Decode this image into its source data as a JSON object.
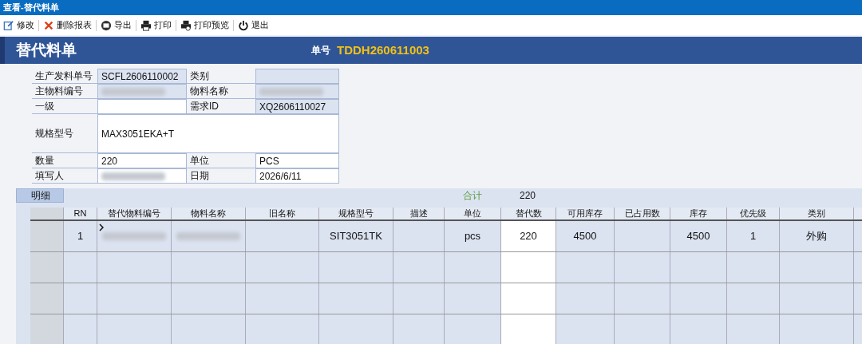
{
  "window": {
    "title": "查看-替代料单"
  },
  "toolbar": [
    {
      "label": "修改",
      "kind": "edit"
    },
    {
      "label": "删除报表",
      "kind": "delete"
    },
    {
      "label": "导出",
      "kind": "export"
    },
    {
      "label": "打印",
      "kind": "print"
    },
    {
      "label": "打印预览",
      "kind": "preview"
    },
    {
      "label": "退出",
      "kind": "exit"
    }
  ],
  "header": {
    "title": "替代料单",
    "number_label": "单号",
    "number": "TDDH260611003"
  },
  "form": {
    "rows": [
      {
        "kind": "pair",
        "fields": [
          {
            "label": "生产发料单号",
            "value": "SCFL2606110002",
            "readonly": true
          },
          {
            "label": "类别",
            "readonly": true
          }
        ]
      },
      {
        "kind": "pair",
        "fields": [
          {
            "label": "主物料编号",
            "redacted": true,
            "readonly": true
          },
          {
            "label": "物料名称",
            "redacted": true,
            "readonly": true
          }
        ]
      },
      {
        "kind": "pair",
        "fields": [
          {
            "label": "一级",
            "readonly": false
          },
          {
            "label": "需求ID",
            "value": "XQ2606110027",
            "readonly": true
          }
        ]
      },
      {
        "kind": "wide",
        "fields": [
          {
            "label": "规格型号",
            "value": "MAX3051EKA+T",
            "readonly": false
          }
        ]
      },
      {
        "kind": "pair",
        "fields": [
          {
            "label": "数量",
            "value": "220",
            "readonly": false
          },
          {
            "label": "单位",
            "value": "PCS",
            "readonly": false
          }
        ]
      },
      {
        "kind": "pair",
        "fields": [
          {
            "label": "填写人",
            "redacted": true,
            "readonly": false
          },
          {
            "label": "日期",
            "value": "2026/6/11",
            "readonly": false
          }
        ]
      }
    ]
  },
  "detail": {
    "tab": "明细",
    "total_label": "合计",
    "total": "220",
    "columns": [
      {
        "label": "RN",
        "editable": false
      },
      {
        "label": "替代物料编号",
        "editable": false
      },
      {
        "label": "物料名称",
        "editable": false
      },
      {
        "label": "旧名称",
        "editable": false
      },
      {
        "label": "规格型号",
        "editable": false
      },
      {
        "label": "描述",
        "editable": false
      },
      {
        "label": "单位",
        "editable": false
      },
      {
        "label": "替代数",
        "editable": true
      },
      {
        "label": "可用库存",
        "editable": false
      },
      {
        "label": "已占用数",
        "editable": false
      },
      {
        "label": "库存",
        "editable": false
      },
      {
        "label": "优先级",
        "editable": false
      },
      {
        "label": "类别",
        "editable": false
      }
    ],
    "rows": [
      {
        "current": true,
        "cells": [
          {
            "text": "1"
          },
          {
            "redacted": true
          },
          {
            "redacted": true
          },
          {},
          {
            "text": "SIT3051TK"
          },
          {},
          {
            "text": "pcs"
          },
          {
            "text": "220"
          },
          {
            "text": "4500"
          },
          {},
          {
            "text": "4500"
          },
          {
            "text": "1"
          },
          {
            "text": "外购"
          }
        ]
      },
      {
        "current": false
      },
      {
        "current": false
      },
      {
        "current": false
      }
    ]
  }
}
